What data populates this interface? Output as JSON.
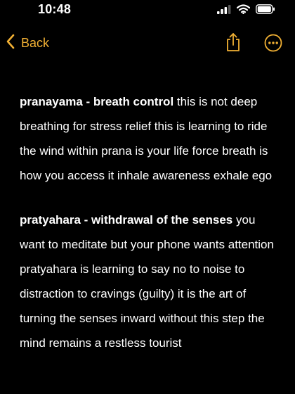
{
  "status_bar": {
    "time": "10:48",
    "icons": [
      "cellular-signal-icon",
      "wifi-icon",
      "battery-icon"
    ]
  },
  "nav": {
    "back_label": "Back",
    "share_icon": "share-icon",
    "more_icon": "more-options-icon",
    "accent_color": "#f2b134"
  },
  "note": {
    "paragraphs": [
      {
        "heading": "pranayama -  breath control",
        "body": " this is not deep breathing for stress relief this is learning to ride the wind within prana is your life force breath is how you access it inhale awareness exhale ego"
      },
      {
        "heading": "pratyahara - withdrawal of the senses",
        "body": " you want to meditate but your phone wants attention pratyahara is learning to say no to noise to distraction to cravings (guilty) it is the art of turning the senses inward without this step the mind remains a restless tourist"
      }
    ]
  }
}
